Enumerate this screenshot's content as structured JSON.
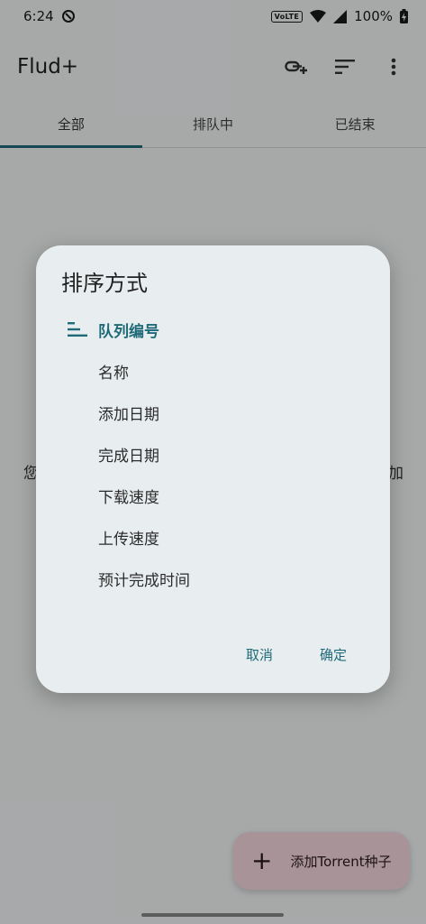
{
  "status_bar": {
    "time": "6:24",
    "volte": "VoLTE",
    "battery": "100%"
  },
  "app_bar": {
    "title": "Flud+"
  },
  "tabs": [
    {
      "label": "全部",
      "active": true
    },
    {
      "label": "排队中",
      "active": false
    },
    {
      "label": "已结束",
      "active": false
    }
  ],
  "background": {
    "empty_left": "您",
    "empty_right": "加"
  },
  "fab": {
    "label": "添加Torrent种子"
  },
  "dialog": {
    "title": "排序方式",
    "options": [
      {
        "label": "队列编号",
        "selected": true
      },
      {
        "label": "名称",
        "selected": false
      },
      {
        "label": "添加日期",
        "selected": false
      },
      {
        "label": "完成日期",
        "selected": false
      },
      {
        "label": "下载速度",
        "selected": false
      },
      {
        "label": "上传速度",
        "selected": false
      },
      {
        "label": "预计完成时间",
        "selected": false
      }
    ],
    "cancel_label": "取消",
    "ok_label": "确定"
  },
  "colors": {
    "accent": "#1f6a78",
    "fab_bg": "#f7d9e0",
    "dialog_bg": "#e8eef0"
  }
}
